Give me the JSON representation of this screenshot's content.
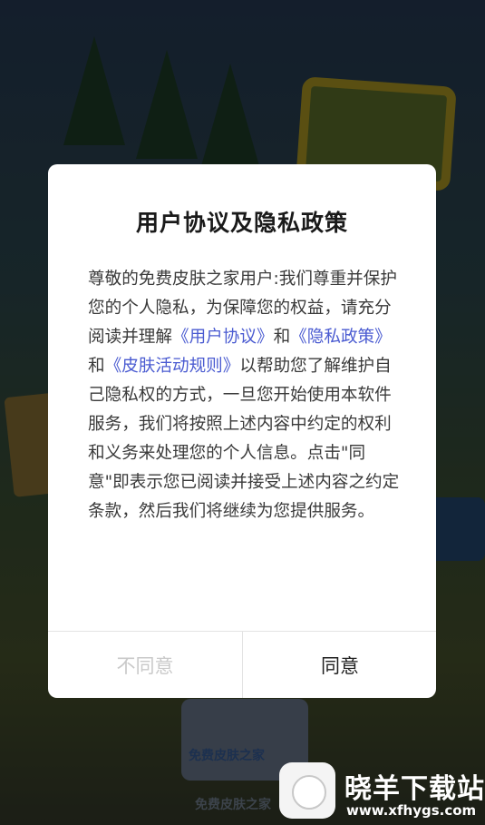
{
  "dialog": {
    "title": "用户协议及隐私政策",
    "body_parts": {
      "p1": "尊敬的免费皮肤之家用户:我们尊重并保护您的个人隐私，为保障您的权益，请充分阅读并理解",
      "link_user_agreement": "《用户协议》",
      "and1": "和",
      "link_privacy_policy": "《隐私政策》",
      "and2": "和",
      "link_activity_rules": "《皮肤活动规则》",
      "p2": "以帮助您了解维护自己隐私权的方式，一旦您开始使用本软件服务，我们将按照上述内容中约定的权利和义务来处理您的个人信息。点击\"同意\"即表示您已阅读并接受上述内容之约定条款，然后我们将继续为您提供服务。"
    },
    "buttons": {
      "disagree": "不同意",
      "agree": "同意"
    }
  },
  "background": {
    "bottom_label": "免费皮肤之家",
    "footer_text": "免费皮肤之家"
  },
  "watermark": {
    "name": "晓羊下载站",
    "url": "www.xfhygs.com"
  },
  "colors": {
    "link": "#4a5bd1",
    "disabled_button": "#c9c9c9",
    "dialog_background": "#ffffff"
  }
}
